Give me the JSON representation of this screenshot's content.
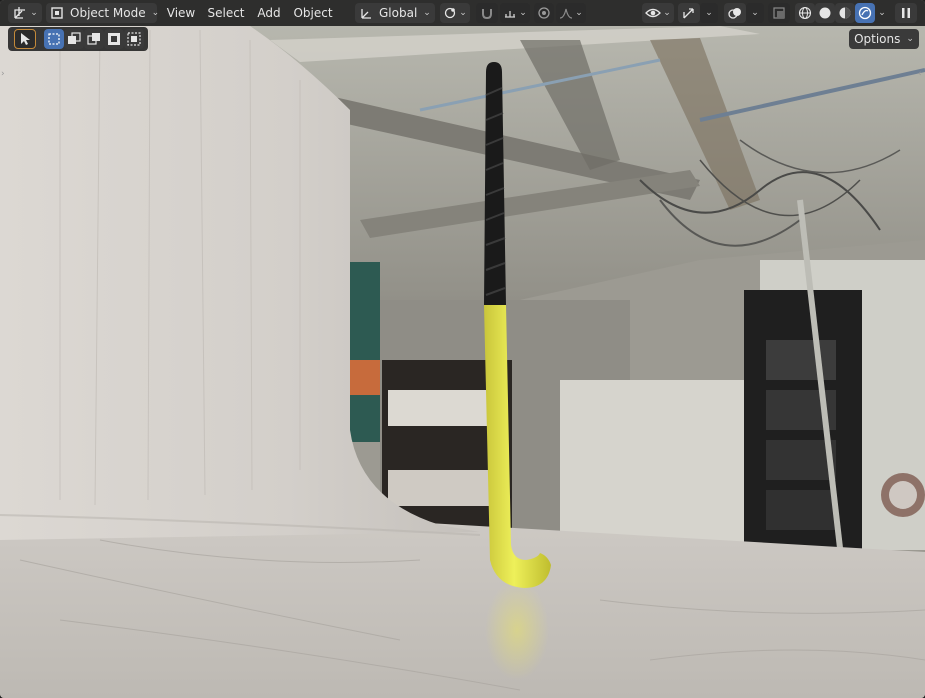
{
  "header": {
    "mode_label": "Object Mode",
    "menu": [
      "View",
      "Select",
      "Add",
      "Object"
    ],
    "orientation_label": "Global"
  },
  "tool_options": {
    "options_label": "Options"
  },
  "icons": {
    "editor_type": "3d-viewport-icon",
    "mode": "object-mode-icon",
    "orientation": "transform-orientation-icon",
    "pivot": "pivot-point-icon",
    "snap": "snap-magnet-icon",
    "snap_target": "snap-increment-icon",
    "proportional": "proportional-editing-icon",
    "falloff": "falloff-curve-icon",
    "visibility": "eye-icon",
    "gizmo": "gizmo-icon",
    "overlays": "overlays-icon",
    "xray": "xray-icon",
    "shading_wire": "wireframe-sphere-icon",
    "shading_solid": "solid-sphere-icon",
    "shading_material": "material-sphere-icon",
    "shading_rendered": "rendered-sphere-icon",
    "pause": "pause-icon"
  },
  "colors": {
    "accent": "#4772b3",
    "header_bg": "#282828",
    "stick_yellow": "#e3e54a",
    "stick_grip": "#1a1a1a"
  }
}
